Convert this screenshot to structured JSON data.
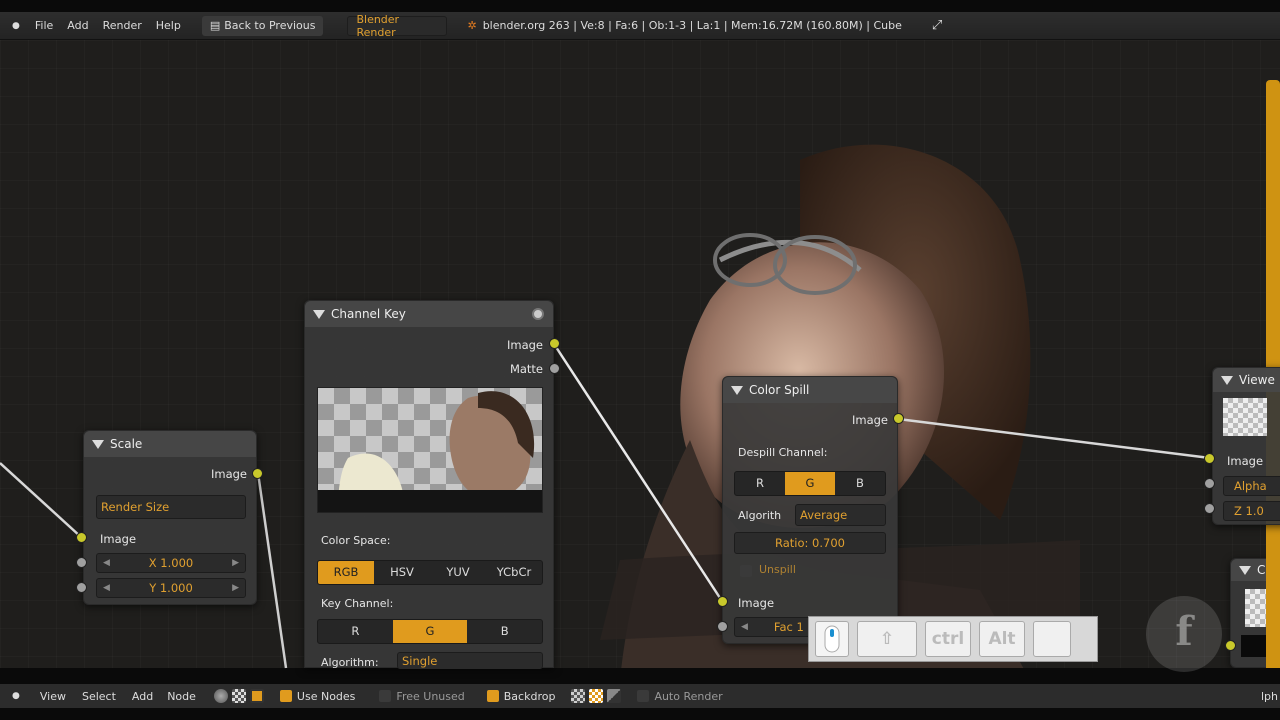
{
  "topbar": {
    "menus": [
      "File",
      "Add",
      "Render",
      "Help"
    ],
    "back_label": "Back to Previous",
    "engine": "Blender Render",
    "stats": "blender.org 263 | Ve:8 | Fa:6 | Ob:1-3 | La:1 | Mem:16.72M (160.80M) | Cube"
  },
  "channel_key": {
    "title": "Channel Key",
    "out_image": "Image",
    "out_matte": "Matte",
    "color_space_label": "Color Space:",
    "color_spaces": [
      "RGB",
      "HSV",
      "YUV",
      "YCbCr"
    ],
    "color_space_selected": 0,
    "key_channel_label": "Key Channel:",
    "key_channels": [
      "R",
      "G",
      "B"
    ],
    "key_channel_selected": 1,
    "algorithm_label": "Algorithm:",
    "algorithm_value": "Single"
  },
  "scale": {
    "title": "Scale",
    "out_image": "Image",
    "mode": "Render Size",
    "in_image": "Image",
    "x": "X 1.000",
    "y": "Y 1.000"
  },
  "color_spill": {
    "title": "Color Spill",
    "out_image": "Image",
    "despill_label": "Despill Channel:",
    "channels": [
      "R",
      "G",
      "B"
    ],
    "channel_selected": 1,
    "algorithm_label": "Algorith",
    "algorithm_value": "Average",
    "ratio": "Ratio: 0.700",
    "unspill": "Unspill",
    "in_image": "Image",
    "fac": "Fac 1"
  },
  "viewer": {
    "title": "Viewe",
    "image": "Image",
    "alpha": "Alpha",
    "z": "Z 1.0"
  },
  "partial_node_title": "C",
  "keys": [
    "ctrl",
    "Alt"
  ],
  "bottombar": {
    "menus": [
      "View",
      "Select",
      "Add",
      "Node"
    ],
    "use_nodes": "Use Nodes",
    "free_unused": "Free Unused",
    "backdrop": "Backdrop",
    "auto_render": "Auto Render",
    "edge_text": "lph"
  },
  "colors": {
    "accent": "#e09b1e",
    "socket_image": "#c8c82b",
    "socket_value": "#a0a0a0"
  }
}
